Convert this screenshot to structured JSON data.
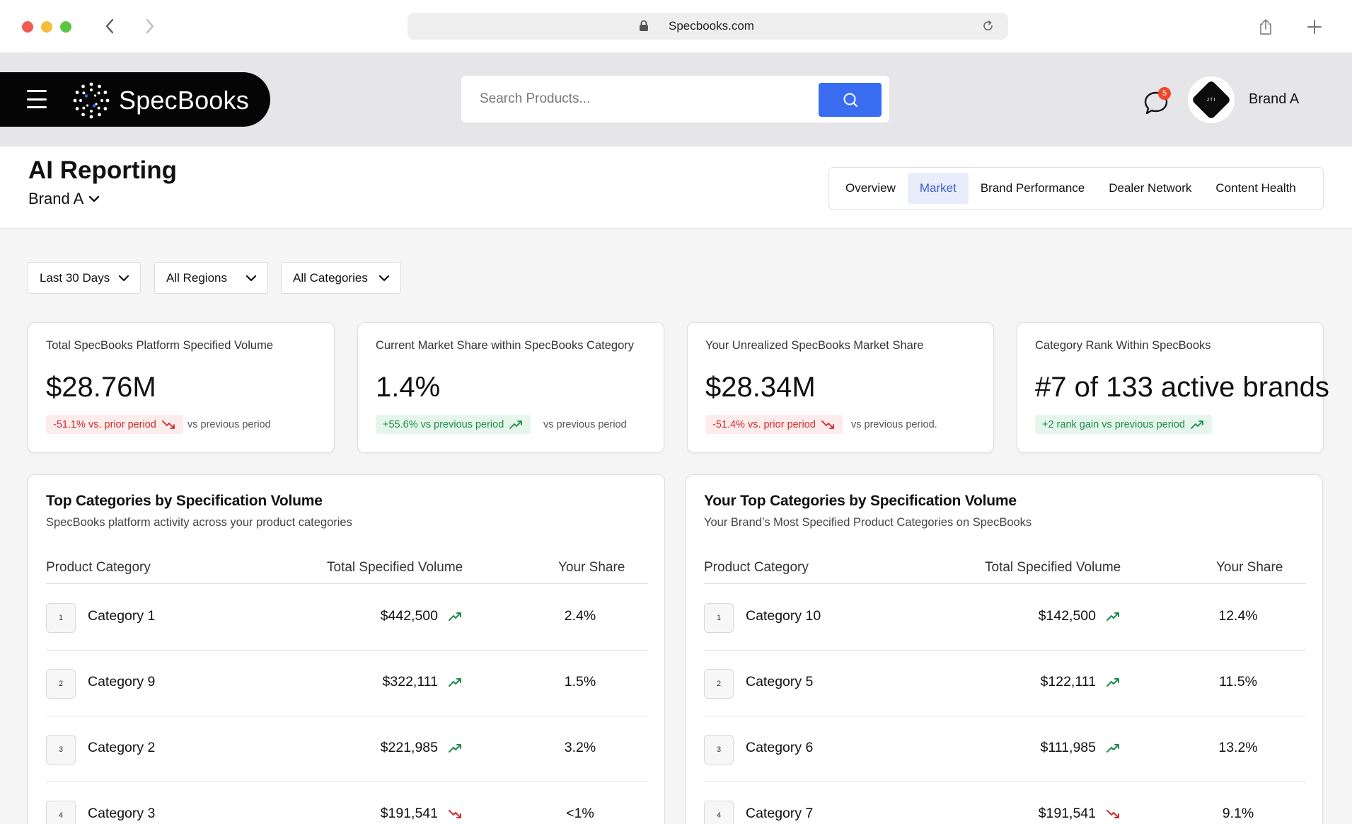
{
  "browser": {
    "url": "Specbooks.com"
  },
  "header": {
    "logo_text": "SpecBooks",
    "search_placeholder": "Search Products...",
    "notification_count": "5",
    "avatar_text": "JTI",
    "user_name": "Brand A"
  },
  "page": {
    "title": "AI Reporting",
    "brand_selector": "Brand A"
  },
  "tabs": [
    {
      "label": "Overview",
      "active": false
    },
    {
      "label": "Market",
      "active": true
    },
    {
      "label": "Brand Performance",
      "active": false
    },
    {
      "label": "Dealer Network",
      "active": false
    },
    {
      "label": "Content Health",
      "active": false
    }
  ],
  "filters": [
    {
      "label": "Last 30 Days"
    },
    {
      "label": "All Regions"
    },
    {
      "label": "All Categories"
    }
  ],
  "kpis": [
    {
      "label": "Total SpecBooks Platform Specified Volume",
      "value": "$28.76M",
      "badge": "-51.1% vs. prior period",
      "trend": "down",
      "sub": "vs previous period"
    },
    {
      "label": "Current Market Share within SpecBooks Category",
      "value": "1.4%",
      "badge": "+55.6% vs previous period",
      "trend": "up",
      "sub": "vs previous period"
    },
    {
      "label": "Your Unrealized SpecBooks Market Share",
      "value": "$28.34M",
      "badge": "-51.4% vs. prior period",
      "trend": "down",
      "sub": "vs previous period."
    },
    {
      "label": "Category Rank Within SpecBooks",
      "value": "#7 of 133 active brands",
      "badge": "+2 rank gain vs previous period",
      "trend": "up",
      "sub": ""
    }
  ],
  "tables": [
    {
      "title": "Top Categories by Specification Volume",
      "subtitle": "SpecBooks platform activity across your product categories",
      "columns": [
        "Product Category",
        "Total Specified Volume",
        "Your Share"
      ],
      "rows": [
        {
          "rank": "1",
          "category": "Category 1",
          "volume": "$442,500",
          "trend": "up",
          "share": "2.4%"
        },
        {
          "rank": "2",
          "category": "Category 9",
          "volume": "$322,111",
          "trend": "up",
          "share": "1.5%"
        },
        {
          "rank": "3",
          "category": "Category 2",
          "volume": "$221,985",
          "trend": "up",
          "share": "3.2%"
        },
        {
          "rank": "4",
          "category": "Category 3",
          "volume": "$191,541",
          "trend": "down",
          "share": "<1%"
        }
      ]
    },
    {
      "title": "Your Top Categories by Specification Volume",
      "subtitle": "Your Brand’s Most Specified Product Categories on SpecBooks",
      "columns": [
        "Product Category",
        "Total Specified Volume",
        "Your Share"
      ],
      "rows": [
        {
          "rank": "1",
          "category": "Category 10",
          "volume": "$142,500",
          "trend": "up",
          "share": "12.4%"
        },
        {
          "rank": "2",
          "category": "Category 5",
          "volume": "$122,111",
          "trend": "up",
          "share": "11.5%"
        },
        {
          "rank": "3",
          "category": "Category 6",
          "volume": "$111,985",
          "trend": "up",
          "share": "13.2%"
        },
        {
          "rank": "4",
          "category": "Category 7",
          "volume": "$191,541",
          "trend": "down",
          "share": "9.1%"
        }
      ]
    }
  ],
  "colors": {
    "accent": "#3a6cf2",
    "positive": "#1c8a4a",
    "negative": "#d12a2a"
  }
}
